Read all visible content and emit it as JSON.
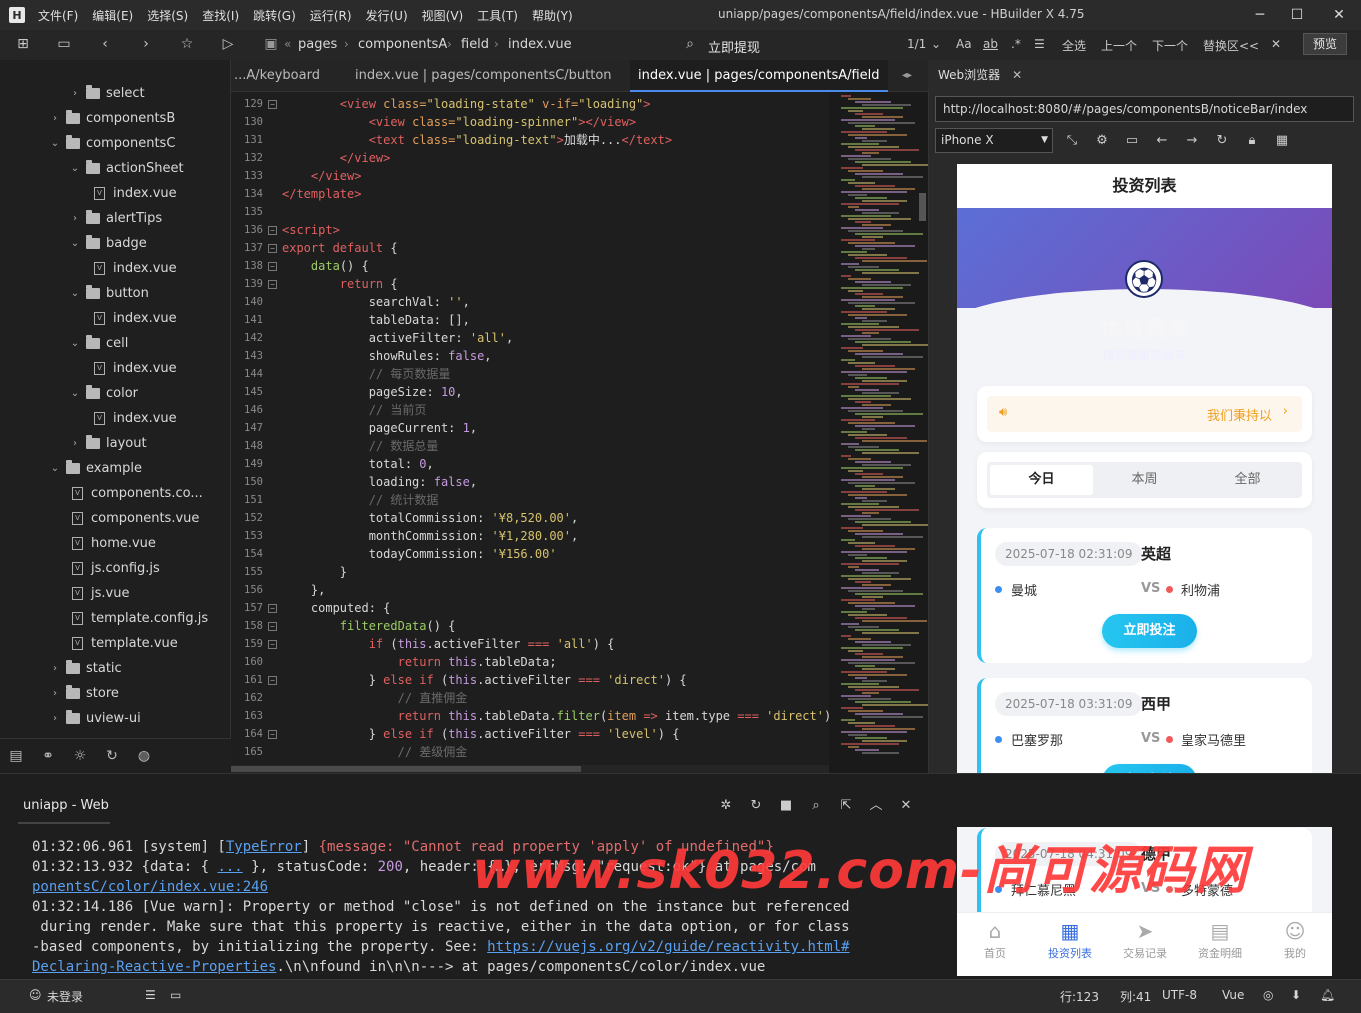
{
  "app": {
    "window_title": "uniapp/pages/componentsA/field/index.vue - HBuilder X 4.75",
    "menus": [
      "文件(F)",
      "编辑(E)",
      "选择(S)",
      "查找(I)",
      "跳转(G)",
      "运行(R)",
      "发行(U)",
      "视图(V)",
      "工具(T)",
      "帮助(Y)"
    ]
  },
  "toolbar": {
    "breadcrumb": [
      "pages",
      "componentsA",
      "field",
      "index.vue"
    ],
    "hint": "立即提现",
    "match_count": "1/1",
    "case_label": "Aa",
    "word_label": "ab",
    "regex_label": ".*",
    "select_all": "全选",
    "prev": "上一个",
    "next": "下一个",
    "replace": "替换区<<",
    "preview": "预览"
  },
  "sidebar": {
    "items": [
      {
        "label": "select",
        "type": "folder",
        "indent": 2,
        "expanded": false
      },
      {
        "label": "componentsB",
        "type": "folder",
        "indent": 1,
        "expanded": false
      },
      {
        "label": "componentsC",
        "type": "folder",
        "indent": 1,
        "expanded": true
      },
      {
        "label": "actionSheet",
        "type": "folder",
        "indent": 2,
        "expanded": true
      },
      {
        "label": "index.vue",
        "type": "file",
        "indent": 3
      },
      {
        "label": "alertTips",
        "type": "folder",
        "indent": 2,
        "expanded": false
      },
      {
        "label": "badge",
        "type": "folder",
        "indent": 2,
        "expanded": true
      },
      {
        "label": "index.vue",
        "type": "file",
        "indent": 3
      },
      {
        "label": "button",
        "type": "folder",
        "indent": 2,
        "expanded": true
      },
      {
        "label": "index.vue",
        "type": "file",
        "indent": 3
      },
      {
        "label": "cell",
        "type": "folder",
        "indent": 2,
        "expanded": true
      },
      {
        "label": "index.vue",
        "type": "file",
        "indent": 3
      },
      {
        "label": "color",
        "type": "folder",
        "indent": 2,
        "expanded": true
      },
      {
        "label": "index.vue",
        "type": "file",
        "indent": 3
      },
      {
        "label": "layout",
        "type": "folder",
        "indent": 2,
        "expanded": false
      },
      {
        "label": "example",
        "type": "folder",
        "indent": 1,
        "expanded": true
      },
      {
        "label": "components.co...",
        "type": "file",
        "indent": 2
      },
      {
        "label": "components.vue",
        "type": "file",
        "indent": 2
      },
      {
        "label": "home.vue",
        "type": "file",
        "indent": 2
      },
      {
        "label": "js.config.js",
        "type": "file",
        "indent": 2
      },
      {
        "label": "js.vue",
        "type": "file",
        "indent": 2
      },
      {
        "label": "template.config.js",
        "type": "file",
        "indent": 2
      },
      {
        "label": "template.vue",
        "type": "file",
        "indent": 2
      },
      {
        "label": "static",
        "type": "folder",
        "indent": 1,
        "expanded": false
      },
      {
        "label": "store",
        "type": "folder",
        "indent": 1,
        "expanded": false
      },
      {
        "label": "uview-ui",
        "type": "folder",
        "indent": 1,
        "expanded": false
      }
    ]
  },
  "editor": {
    "tabs": [
      {
        "label": "...A/keyboard",
        "active": false
      },
      {
        "label": "index.vue | pages/componentsC/button",
        "active": false
      },
      {
        "label": "index.vue | pages/componentsA/field",
        "active": true
      }
    ],
    "lines": [
      {
        "n": "129",
        "f": "-",
        "t": [
          [
            "        ",
            "pl"
          ],
          [
            "<view ",
            "tag"
          ],
          [
            "class=",
            "attr"
          ],
          [
            "\"loading-state\"",
            "str"
          ],
          [
            " v-if=",
            "attr"
          ],
          [
            "\"loading\"",
            "str"
          ],
          [
            ">",
            "tag"
          ]
        ]
      },
      {
        "n": "130",
        "f": "",
        "t": [
          [
            "            ",
            "pl"
          ],
          [
            "<view ",
            "tag"
          ],
          [
            "class=",
            "attr"
          ],
          [
            "\"loading-spinner\"",
            "str"
          ],
          [
            "></view>",
            "tag"
          ]
        ]
      },
      {
        "n": "131",
        "f": "",
        "t": [
          [
            "            ",
            "pl"
          ],
          [
            "<text ",
            "tag"
          ],
          [
            "class=",
            "attr"
          ],
          [
            "\"loading-text\"",
            "str"
          ],
          [
            ">",
            "tag"
          ],
          [
            "加载中...",
            "pl"
          ],
          [
            "</text>",
            "tag"
          ]
        ]
      },
      {
        "n": "132",
        "f": "",
        "t": [
          [
            "        ",
            "pl"
          ],
          [
            "</view>",
            "tag"
          ]
        ]
      },
      {
        "n": "133",
        "f": "",
        "t": [
          [
            "    ",
            "pl"
          ],
          [
            "</view>",
            "tag"
          ]
        ]
      },
      {
        "n": "134",
        "f": "",
        "t": [
          [
            "</template>",
            "tag"
          ]
        ]
      },
      {
        "n": "135",
        "f": "",
        "t": [
          [
            "",
            "pl"
          ]
        ]
      },
      {
        "n": "136",
        "f": "-",
        "t": [
          [
            "<script>",
            "tag"
          ]
        ]
      },
      {
        "n": "137",
        "f": "-",
        "t": [
          [
            "export default",
            "kw"
          ],
          [
            " {",
            "pl"
          ]
        ]
      },
      {
        "n": "138",
        "f": "-",
        "t": [
          [
            "    ",
            "pl"
          ],
          [
            "data",
            "fn"
          ],
          [
            "() {",
            "pl"
          ]
        ]
      },
      {
        "n": "139",
        "f": "-",
        "t": [
          [
            "        ",
            "pl"
          ],
          [
            "return",
            "kw"
          ],
          [
            " {",
            "pl"
          ]
        ]
      },
      {
        "n": "140",
        "f": "",
        "t": [
          [
            "            searchVal: ",
            "pl"
          ],
          [
            "''",
            "str"
          ],
          [
            ",",
            "pl"
          ]
        ]
      },
      {
        "n": "141",
        "f": "",
        "t": [
          [
            "            tableData: [],",
            "pl"
          ]
        ]
      },
      {
        "n": "142",
        "f": "",
        "t": [
          [
            "            activeFilter: ",
            "pl"
          ],
          [
            "'all'",
            "str"
          ],
          [
            ",",
            "pl"
          ]
        ]
      },
      {
        "n": "143",
        "f": "",
        "t": [
          [
            "            showRules: ",
            "pl"
          ],
          [
            "false",
            "num"
          ],
          [
            ",",
            "pl"
          ]
        ]
      },
      {
        "n": "144",
        "f": "",
        "t": [
          [
            "            ",
            "pl"
          ],
          [
            "// 每页数据量",
            "cm"
          ]
        ]
      },
      {
        "n": "145",
        "f": "",
        "t": [
          [
            "            pageSize: ",
            "pl"
          ],
          [
            "10",
            "num"
          ],
          [
            ",",
            "pl"
          ]
        ]
      },
      {
        "n": "146",
        "f": "",
        "t": [
          [
            "            ",
            "pl"
          ],
          [
            "// 当前页",
            "cm"
          ]
        ]
      },
      {
        "n": "147",
        "f": "",
        "t": [
          [
            "            pageCurrent: ",
            "pl"
          ],
          [
            "1",
            "num"
          ],
          [
            ",",
            "pl"
          ]
        ]
      },
      {
        "n": "148",
        "f": "",
        "t": [
          [
            "            ",
            "pl"
          ],
          [
            "// 数据总量",
            "cm"
          ]
        ]
      },
      {
        "n": "149",
        "f": "",
        "t": [
          [
            "            total: ",
            "pl"
          ],
          [
            "0",
            "num"
          ],
          [
            ",",
            "pl"
          ]
        ]
      },
      {
        "n": "150",
        "f": "",
        "t": [
          [
            "            loading: ",
            "pl"
          ],
          [
            "false",
            "num"
          ],
          [
            ",",
            "pl"
          ]
        ]
      },
      {
        "n": "151",
        "f": "",
        "t": [
          [
            "            ",
            "pl"
          ],
          [
            "// 统计数据",
            "cm"
          ]
        ]
      },
      {
        "n": "152",
        "f": "",
        "t": [
          [
            "            totalCommission: ",
            "pl"
          ],
          [
            "'¥8,520.00'",
            "str"
          ],
          [
            ",",
            "pl"
          ]
        ]
      },
      {
        "n": "153",
        "f": "",
        "t": [
          [
            "            monthCommission: ",
            "pl"
          ],
          [
            "'¥1,280.00'",
            "str"
          ],
          [
            ",",
            "pl"
          ]
        ]
      },
      {
        "n": "154",
        "f": "",
        "t": [
          [
            "            todayCommission: ",
            "pl"
          ],
          [
            "'¥156.00'",
            "str"
          ]
        ]
      },
      {
        "n": "155",
        "f": "",
        "t": [
          [
            "        }",
            "pl"
          ]
        ]
      },
      {
        "n": "156",
        "f": "",
        "t": [
          [
            "    },",
            "pl"
          ]
        ]
      },
      {
        "n": "157",
        "f": "-",
        "t": [
          [
            "    computed: {",
            "pl"
          ]
        ]
      },
      {
        "n": "158",
        "f": "-",
        "t": [
          [
            "        ",
            "pl"
          ],
          [
            "filteredData",
            "fn"
          ],
          [
            "() {",
            "pl"
          ]
        ]
      },
      {
        "n": "159",
        "f": "-",
        "t": [
          [
            "            ",
            "pl"
          ],
          [
            "if",
            "kw"
          ],
          [
            " (",
            "pl"
          ],
          [
            "this",
            "this"
          ],
          [
            ".activeFilter ",
            "pl"
          ],
          [
            "===",
            "kw"
          ],
          [
            " ",
            "pl"
          ],
          [
            "'all'",
            "str"
          ],
          [
            ") {",
            "pl"
          ]
        ]
      },
      {
        "n": "160",
        "f": "",
        "t": [
          [
            "                ",
            "pl"
          ],
          [
            "return",
            "kw"
          ],
          [
            " ",
            "pl"
          ],
          [
            "this",
            "this"
          ],
          [
            ".tableData;",
            "pl"
          ]
        ]
      },
      {
        "n": "161",
        "f": "-",
        "t": [
          [
            "            } ",
            "pl"
          ],
          [
            "else if",
            "kw"
          ],
          [
            " (",
            "pl"
          ],
          [
            "this",
            "this"
          ],
          [
            ".activeFilter ",
            "pl"
          ],
          [
            "===",
            "kw"
          ],
          [
            " ",
            "pl"
          ],
          [
            "'direct'",
            "str"
          ],
          [
            ") {",
            "pl"
          ]
        ]
      },
      {
        "n": "162",
        "f": "",
        "t": [
          [
            "                ",
            "pl"
          ],
          [
            "// 直推佣金",
            "cm"
          ]
        ]
      },
      {
        "n": "163",
        "f": "",
        "t": [
          [
            "                ",
            "pl"
          ],
          [
            "return",
            "kw"
          ],
          [
            " ",
            "pl"
          ],
          [
            "this",
            "this"
          ],
          [
            ".tableData.",
            "pl"
          ],
          [
            "filter",
            "fn"
          ],
          [
            "(",
            "pl"
          ],
          [
            "item",
            "attr"
          ],
          [
            " ",
            "pl"
          ],
          [
            "=>",
            "kw"
          ],
          [
            " item.type ",
            "pl"
          ],
          [
            "===",
            "kw"
          ],
          [
            " ",
            "pl"
          ],
          [
            "'direct'",
            "str"
          ],
          [
            ");",
            "pl"
          ]
        ]
      },
      {
        "n": "164",
        "f": "-",
        "t": [
          [
            "            } ",
            "pl"
          ],
          [
            "else if",
            "kw"
          ],
          [
            " (",
            "pl"
          ],
          [
            "this",
            "this"
          ],
          [
            ".activeFilter ",
            "pl"
          ],
          [
            "===",
            "kw"
          ],
          [
            " ",
            "pl"
          ],
          [
            "'level'",
            "str"
          ],
          [
            ") {",
            "pl"
          ]
        ]
      },
      {
        "n": "165",
        "f": "",
        "t": [
          [
            "                ",
            "pl"
          ],
          [
            "// 差级佣金",
            "cm"
          ]
        ]
      }
    ]
  },
  "browser": {
    "tab_label": "Web浏览器",
    "url": "http://localhost:8080/#/pages/componentsB/noticeBar/index",
    "device": "iPhone X"
  },
  "phone": {
    "nav_title": "投资列表",
    "hero_title": "体育赛事",
    "hero_subtitle": "精彩赛事等你来",
    "notice_text": "我们秉持以",
    "tabs": [
      "今日",
      "本周",
      "全部"
    ],
    "active_tab": 0,
    "cta": "立即投注",
    "matches": [
      {
        "time": "2025-07-18 02:31:09",
        "league": "英超",
        "home": "曼城",
        "away": "利物浦",
        "vs": "VS"
      },
      {
        "time": "2025-07-18 03:31:09",
        "league": "西甲",
        "home": "巴塞罗那",
        "away": "皇家马德里",
        "vs": "VS"
      },
      {
        "time": "2025-07-18 04:31:09",
        "league": "德甲",
        "home": "拜仁慕尼黑",
        "away": "多特蒙德",
        "vs": "VS"
      }
    ],
    "tabbar": [
      {
        "label": "首页",
        "icon": "home-icon",
        "active": false
      },
      {
        "label": "投资列表",
        "icon": "list-icon",
        "active": true
      },
      {
        "label": "交易记录",
        "icon": "send-icon",
        "active": false
      },
      {
        "label": "资金明细",
        "icon": "ledger-icon",
        "active": false
      },
      {
        "label": "我的",
        "icon": "face-icon",
        "active": false
      }
    ],
    "colors": {
      "accent": "#26c6f0",
      "hero_from": "#5b6fd6",
      "hero_to": "#7b4ab8",
      "notice": "#f0a020"
    }
  },
  "console": {
    "title": "uniapp - Web",
    "lines": [
      [
        [
          "01:32:06.961 [system] [",
          "pl"
        ],
        [
          "TypeError",
          "link"
        ],
        [
          "] ",
          "pl"
        ],
        [
          "{message: \"Cannot read property 'apply' of undefined\"}",
          "err"
        ]
      ],
      [
        [
          "01:32:13.932 {data: { ",
          "pl"
        ],
        [
          "...",
          "link"
        ],
        [
          " }, statusCode: ",
          "pl"
        ],
        [
          "200",
          "num"
        ],
        [
          ", header: {…}, errMsg: \"request:ok\"} at pages/com",
          "pl"
        ]
      ],
      [
        [
          "ponentsC/color/index.vue:246",
          "link"
        ]
      ],
      [
        [
          "01:32:14.186 [Vue warn]: Property or method \"close\" is not defined on the instance but referenced",
          "pl"
        ]
      ],
      [
        [
          " during render. Make sure that this property is reactive, either in the data option, or for class",
          "pl"
        ]
      ],
      [
        [
          "-based components, by initializing the property. See: ",
          "pl"
        ],
        [
          "https://vuejs.org/v2/guide/reactivity.html#",
          "link"
        ]
      ],
      [
        [
          "Declaring-Reactive-Properties",
          "link"
        ],
        [
          ".\\n\\nfound in\\n\\n---> at pages/componentsC/color/index.vue",
          "pl"
        ]
      ]
    ]
  },
  "watermark": "www.sk032.com-尚可源码网",
  "status": {
    "login": "未登录",
    "line": "行:123",
    "col": "列:41",
    "encoding": "UTF-8",
    "lang": "Vue"
  }
}
